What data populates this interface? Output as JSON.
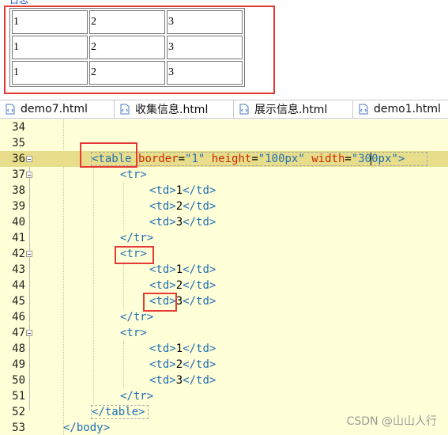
{
  "preview": {
    "label": "日志",
    "table": [
      [
        "1",
        "2",
        "3"
      ],
      [
        "1",
        "2",
        "3"
      ],
      [
        "1",
        "2",
        "3"
      ]
    ]
  },
  "tabs": [
    {
      "label": "demo7.html",
      "icon": "html-file-icon"
    },
    {
      "label": "收集信息.html",
      "icon": "html-file-icon"
    },
    {
      "label": "展示信息.html",
      "icon": "html-file-icon"
    },
    {
      "label": "demo1.html",
      "icon": "html-file-icon"
    }
  ],
  "editor": {
    "lines": [
      {
        "n": "34",
        "code": ""
      },
      {
        "n": "35",
        "code": ""
      },
      {
        "n": "36",
        "code": "<table border=\"1\" height=\"100px\" width=\"300px\">"
      },
      {
        "n": "37",
        "code": "<tr>"
      },
      {
        "n": "38",
        "code": "<td>1</td>"
      },
      {
        "n": "39",
        "code": "<td>2</td>"
      },
      {
        "n": "40",
        "code": "<td>3</td>"
      },
      {
        "n": "41",
        "code": "</tr>"
      },
      {
        "n": "42",
        "code": "<tr>"
      },
      {
        "n": "43",
        "code": "<td>1</td>"
      },
      {
        "n": "44",
        "code": "<td>2</td>"
      },
      {
        "n": "45",
        "code": "<td>3</td>"
      },
      {
        "n": "46",
        "code": "</tr>"
      },
      {
        "n": "47",
        "code": "<tr>"
      },
      {
        "n": "48",
        "code": "<td>1</td>"
      },
      {
        "n": "49",
        "code": "<td>2</td>"
      },
      {
        "n": "50",
        "code": "<td>3</td>"
      },
      {
        "n": "51",
        "code": "</tr>"
      },
      {
        "n": "52",
        "code": "</table>"
      },
      {
        "n": "53",
        "code": "</body>"
      }
    ]
  },
  "watermark": "CSDN @山山人行",
  "colors": {
    "highlight_annotation": "#e53935",
    "editor_background": "#ffffd8",
    "current_line": "#e7dd8a",
    "tag": "#1f6eb5",
    "attribute": "#cc2a00"
  }
}
